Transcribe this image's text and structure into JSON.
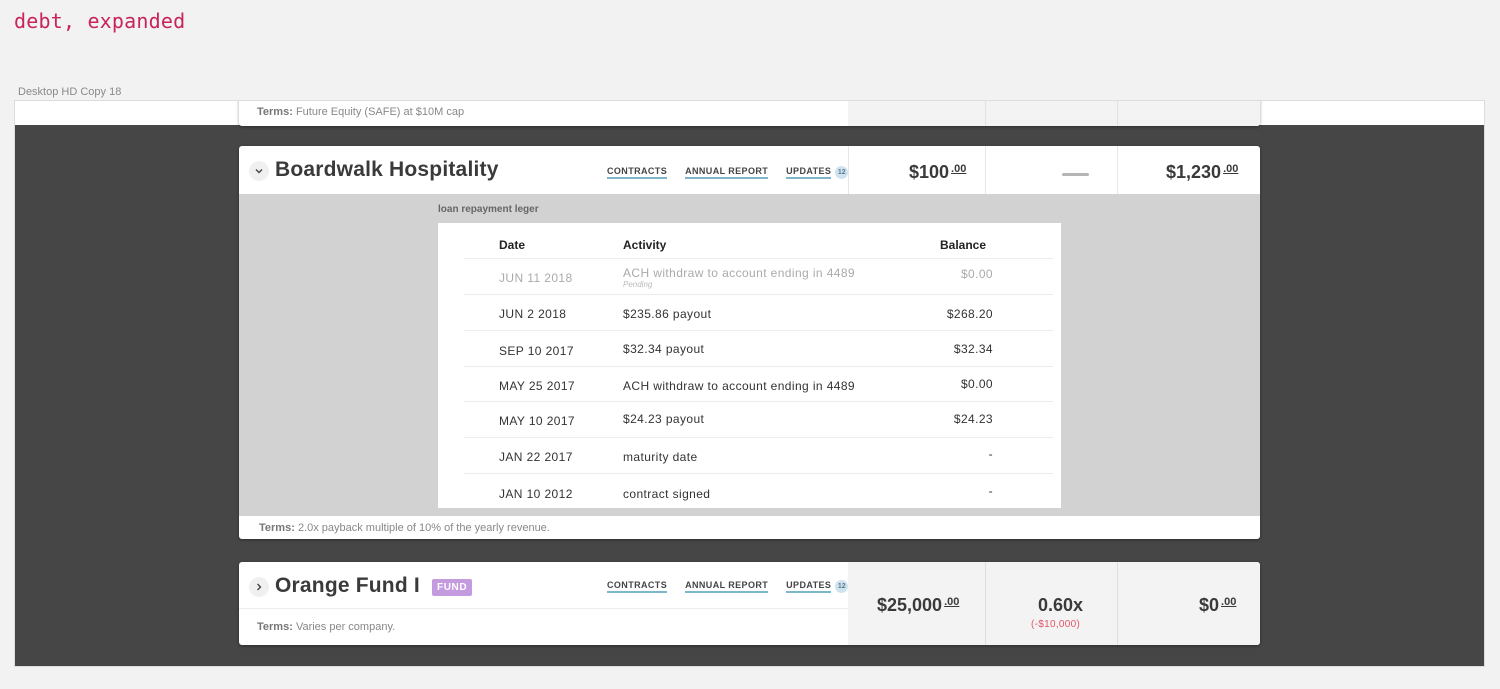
{
  "page_heading": "debt, expanded",
  "artboard_label": "Desktop HD Copy 18",
  "top_card": {
    "terms_label": "Terms:",
    "terms_text": "Future Equity (SAFE) at $10M cap"
  },
  "expanded_card": {
    "company": "Boardwalk Hospitality",
    "expand_icon": "chevron-down",
    "links": {
      "contracts": "CONTRACTS",
      "annual_report": "ANNUAL REPORT",
      "updates": "UPDATES",
      "updates_count": "12"
    },
    "invested": {
      "dollars": "$100",
      "cents": ".00"
    },
    "return_dash": "—",
    "value": {
      "dollars": "$1,230",
      "cents": ".00"
    },
    "ledger": {
      "title": "loan repayment leger",
      "columns": {
        "date": "Date",
        "activity": "Activity",
        "balance": "Balance"
      },
      "rows": [
        {
          "date": "JUN 11 2018",
          "activity": "ACH withdraw to account ending in 4489",
          "balance": "$0.00",
          "note": "Pending"
        },
        {
          "date": "JUN 2 2018",
          "activity": "$235.86 payout",
          "balance": "$268.20"
        },
        {
          "date": "SEP 10 2017",
          "activity": "$32.34 payout",
          "balance": "$32.34"
        },
        {
          "date": "MAY 25 2017",
          "activity": "ACH withdraw to account ending in 4489",
          "balance": "$0.00"
        },
        {
          "date": "MAY 10 2017",
          "activity": "$24.23 payout",
          "balance": "$24.23"
        },
        {
          "date": "JAN 22 2017",
          "activity": "maturity date",
          "balance": "-"
        },
        {
          "date": "JAN 10 2012",
          "activity": "contract signed",
          "balance": "-"
        }
      ]
    },
    "terms_label": "Terms:",
    "terms_text": "2.0x payback multiple of 10% of the yearly revenue."
  },
  "fund_card": {
    "company": "Orange Fund I",
    "expand_icon": "chevron-right",
    "badge": "FUND",
    "links": {
      "contracts": "CONTRACTS",
      "annual_report": "ANNUAL REPORT",
      "updates": "UPDATES",
      "updates_count": "12"
    },
    "invested": {
      "dollars": "$25,000",
      "cents": ".00"
    },
    "multiple": "0.60x",
    "multiple_change": "(-$10,000)",
    "value": {
      "dollars": "$0",
      "cents": ".00"
    },
    "terms_label": "Terms:",
    "terms_text": "Varies per company."
  },
  "colors": {
    "heading": "#c8235a",
    "artboard_bg": "#464646",
    "link_underline": "#7eb6cc",
    "fund_badge": "#c59be0",
    "negative": "#e2556b"
  }
}
